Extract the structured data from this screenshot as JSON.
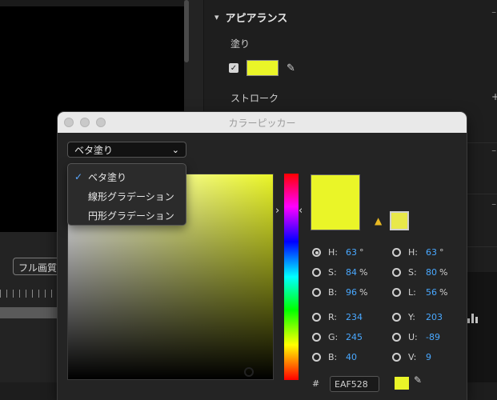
{
  "panel": {
    "title": "アピアランス",
    "fill_label": "塗り",
    "stroke_label": "ストローク",
    "fill_color": "#EAF528"
  },
  "toolbar": {
    "quality_label": "フル画質"
  },
  "picker": {
    "window_title": "カラーピッカー",
    "fill_type_selected": "ベタ塗り",
    "fill_type_options": [
      "ベタ塗り",
      "線形グラデーション",
      "円形グラデーション"
    ],
    "selected_index": 0,
    "current_color": "#EAF528",
    "gamut_warning_color": "#E8E84A",
    "hex_prefix": "#",
    "hex_value": "EAF528",
    "values": {
      "hsb": [
        {
          "label": "H:",
          "value": "63",
          "unit": "°",
          "selected": true
        },
        {
          "label": "S:",
          "value": "84",
          "unit": "%"
        },
        {
          "label": "B:",
          "value": "96",
          "unit": "%"
        }
      ],
      "hsl": [
        {
          "label": "H:",
          "value": "63",
          "unit": "°"
        },
        {
          "label": "S:",
          "value": "80",
          "unit": "%"
        },
        {
          "label": "L:",
          "value": "56",
          "unit": "%"
        }
      ],
      "rgb": [
        {
          "label": "R:",
          "value": "234"
        },
        {
          "label": "G:",
          "value": "245"
        },
        {
          "label": "B:",
          "value": "40"
        }
      ],
      "yuv": [
        {
          "label": "Y:",
          "value": "203"
        },
        {
          "label": "U:",
          "value": "-89"
        },
        {
          "label": "V:",
          "value": "9"
        }
      ]
    }
  },
  "icons": {
    "chevron_down": "chevron-down-icon",
    "eyedropper": "eyedropper-icon",
    "warning": "warning-icon",
    "checkmark": "checkmark-icon"
  }
}
